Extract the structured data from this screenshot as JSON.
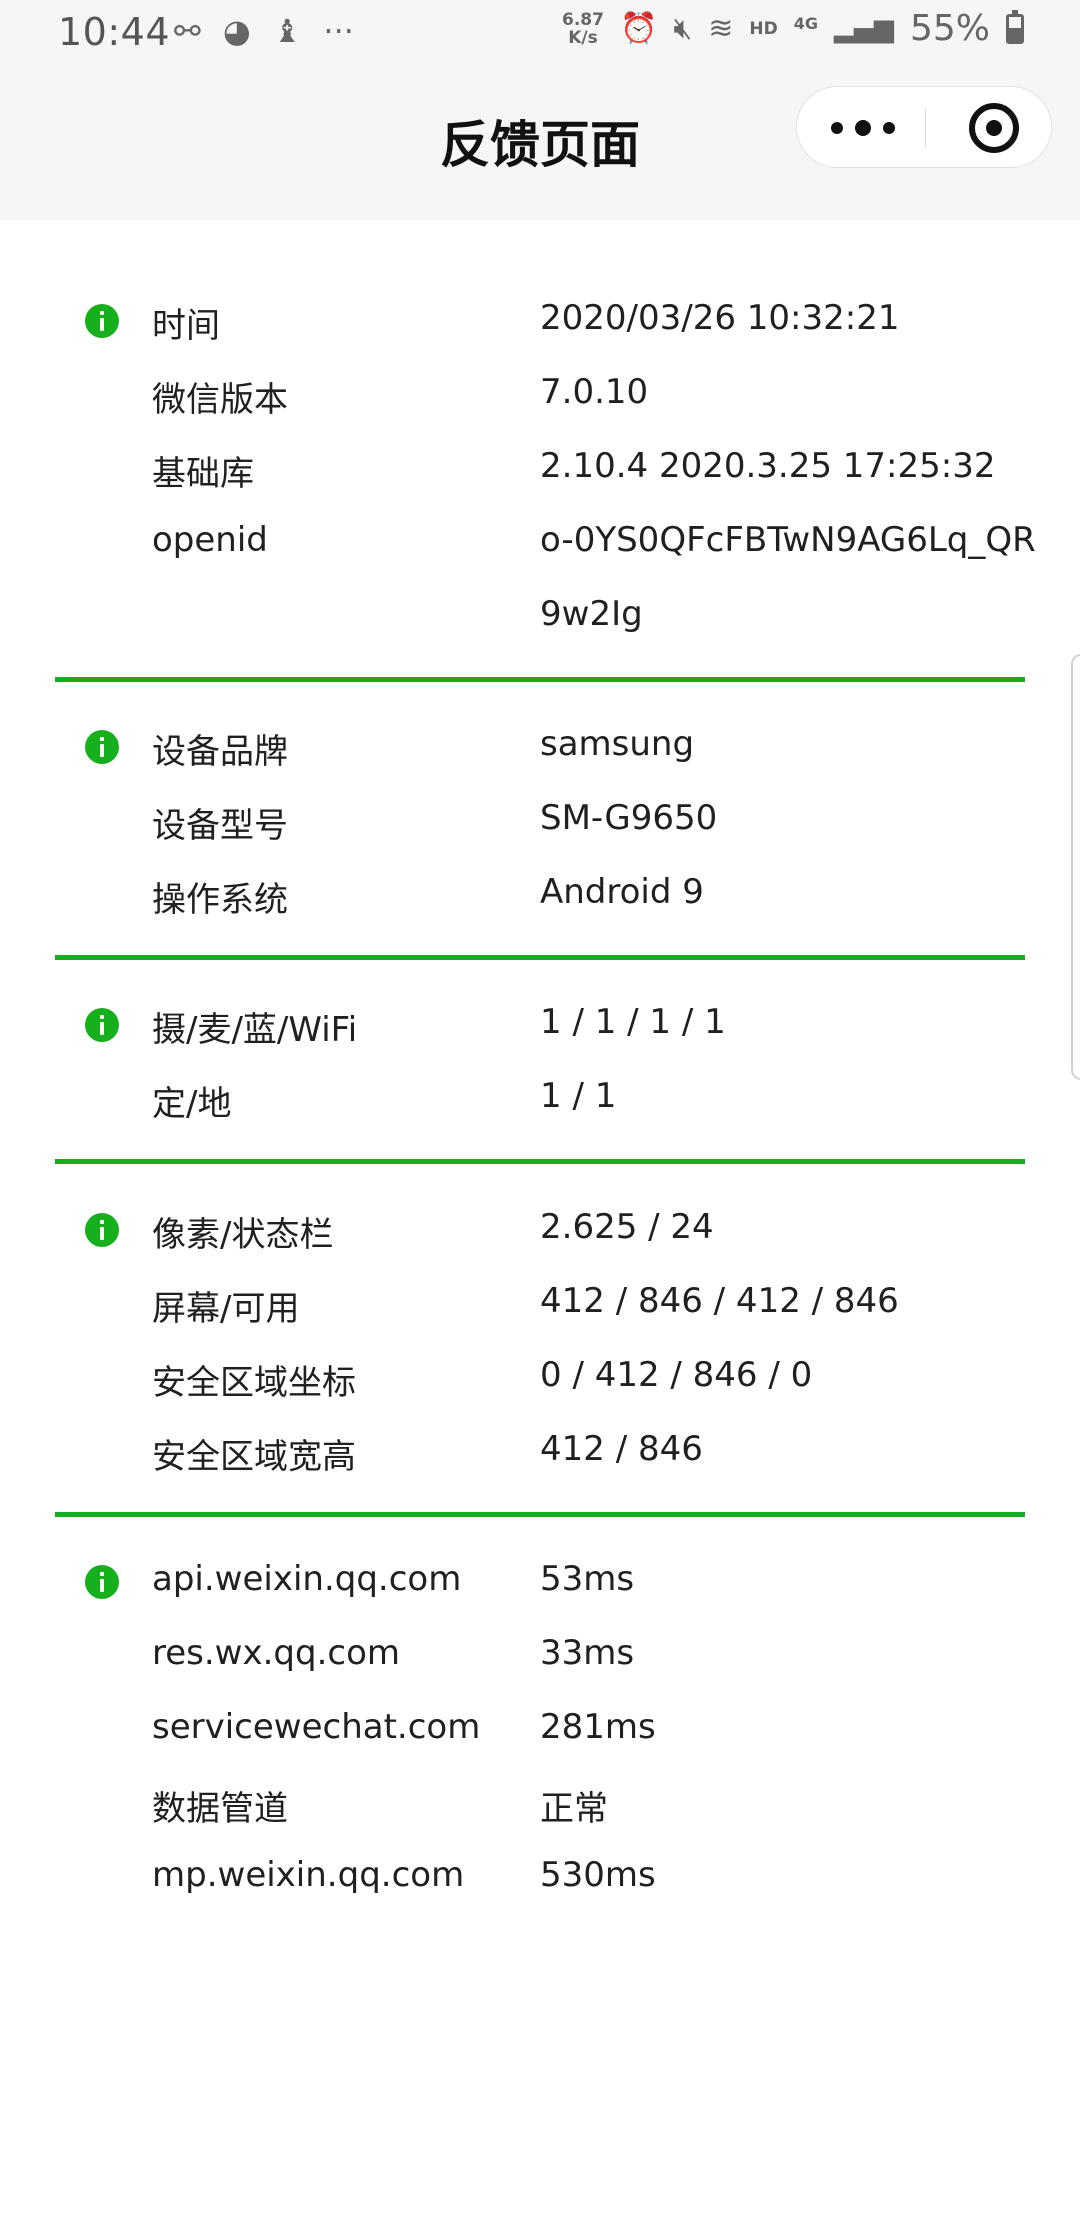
{
  "status_bar": {
    "time": "10:44",
    "left_icons": [
      "link-icon",
      "wechat-icon",
      "moneybag-icon",
      "more-dots-icon"
    ],
    "net_speed_value": "6.87",
    "net_speed_unit": "K/s",
    "hd": "HD",
    "network": "4G",
    "battery": "55%"
  },
  "nav": {
    "title": "反馈页面"
  },
  "sections": [
    {
      "rows": [
        {
          "label": "时间",
          "value": "2020/03/26 10:32:21"
        },
        {
          "label": "微信版本",
          "value": "7.0.10"
        },
        {
          "label": "基础库",
          "value": "2.10.4 2020.3.25 17:25:32"
        },
        {
          "label": "openid",
          "value": "o-0YS0QFcFBTwN9AG6Lq_QR"
        },
        {
          "label": "",
          "value": "9w2Ig"
        }
      ]
    },
    {
      "rows": [
        {
          "label": "设备品牌",
          "value": "samsung"
        },
        {
          "label": "设备型号",
          "value": "SM-G9650"
        },
        {
          "label": "操作系统",
          "value": "Android 9"
        }
      ]
    },
    {
      "rows": [
        {
          "label": "摄/麦/蓝/WiFi",
          "value": "1 / 1 / 1 / 1"
        },
        {
          "label": "定/地",
          "value": "1 / 1"
        }
      ]
    },
    {
      "rows": [
        {
          "label": "像素/状态栏",
          "value": "2.625 / 24"
        },
        {
          "label": "屏幕/可用",
          "value": "412 / 846 / 412 / 846"
        },
        {
          "label": "安全区域坐标",
          "value": "0 / 412 / 846 / 0"
        },
        {
          "label": "安全区域宽高",
          "value": "412 / 846"
        }
      ]
    },
    {
      "rows": [
        {
          "label": "api.weixin.qq.com",
          "value": "53ms"
        },
        {
          "label": "res.wx.qq.com",
          "value": "33ms"
        },
        {
          "label": "servicewechat.com",
          "value": "281ms"
        },
        {
          "label": "数据管道",
          "value": "正常"
        },
        {
          "label": "mp.weixin.qq.com",
          "value": "530ms"
        }
      ]
    }
  ],
  "colors": {
    "accent_green": "#17ad23",
    "header_bg": "#f6f6f6"
  }
}
